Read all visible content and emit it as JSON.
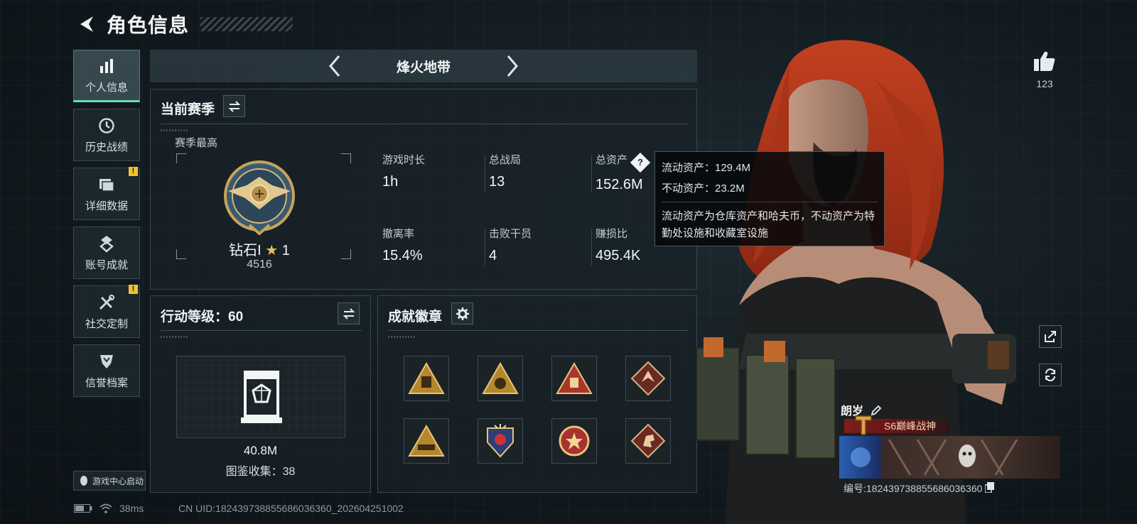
{
  "header": {
    "title": "角色信息"
  },
  "sidebar": {
    "items": [
      {
        "label": "个人信息",
        "icon": "bar-chart-icon",
        "active": true,
        "badge": false
      },
      {
        "label": "历史战绩",
        "icon": "history-icon",
        "active": false,
        "badge": false
      },
      {
        "label": "详细数据",
        "icon": "folder-icon",
        "active": false,
        "badge": true
      },
      {
        "label": "账号成就",
        "icon": "achievement-icon",
        "active": false,
        "badge": false
      },
      {
        "label": "社交定制",
        "icon": "tools-icon",
        "active": false,
        "badge": true
      },
      {
        "label": "信誉档案",
        "icon": "shield-icon",
        "active": false,
        "badge": false
      }
    ],
    "badge_mark": "!",
    "launch_label": "游戏中心启动"
  },
  "season_nav": {
    "mode": "烽火地带"
  },
  "current_season": {
    "title": "当前赛季",
    "best_label": "赛季最高",
    "rank_name": "钻石I",
    "rank_stars": "1",
    "rank_score": "4516",
    "stats": [
      {
        "label": "游戏时长",
        "value": "1h"
      },
      {
        "label": "总战局",
        "value": "13"
      },
      {
        "label": "总资产",
        "value": "152.6M"
      },
      {
        "label": "撤离率",
        "value": "15.4%"
      },
      {
        "label": "击败干员",
        "value": "4"
      },
      {
        "label": "赚损比",
        "value": "495.4K"
      }
    ],
    "help_mark": "?"
  },
  "tooltip": {
    "liquid": "流动资产：129.4M",
    "fixed": "不动资产：23.2M",
    "description": "流动资产为仓库资产和哈夫币，不动资产为特勤处设施和收藏室设施"
  },
  "action_level": {
    "title": "行动等级：60",
    "value": "40.8M",
    "collection": "图鉴收集：38"
  },
  "achievements": {
    "title": "成就徽章",
    "badges": [
      "triangle-backpack-badge",
      "triangle-globe-badge",
      "triangle-crate-badge",
      "diamond-dragon-badge",
      "triangle-tank-badge",
      "shield-wings-badge",
      "round-star-badge",
      "diamond-horse-badge"
    ]
  },
  "profile": {
    "like_count": "123",
    "player_name": "朗岁",
    "player_title": "S6巅峰战神",
    "uid_line": "编号:182439738855686036360"
  },
  "status": {
    "ping": "38ms",
    "cn_uid": "CN UID:182439738855686036360_202604251002"
  },
  "colors": {
    "accent_green": "#5fe0ae",
    "badge_yellow": "#f2c12e",
    "title_red": "#7e1c1c",
    "hair_red": "#b3361c"
  }
}
